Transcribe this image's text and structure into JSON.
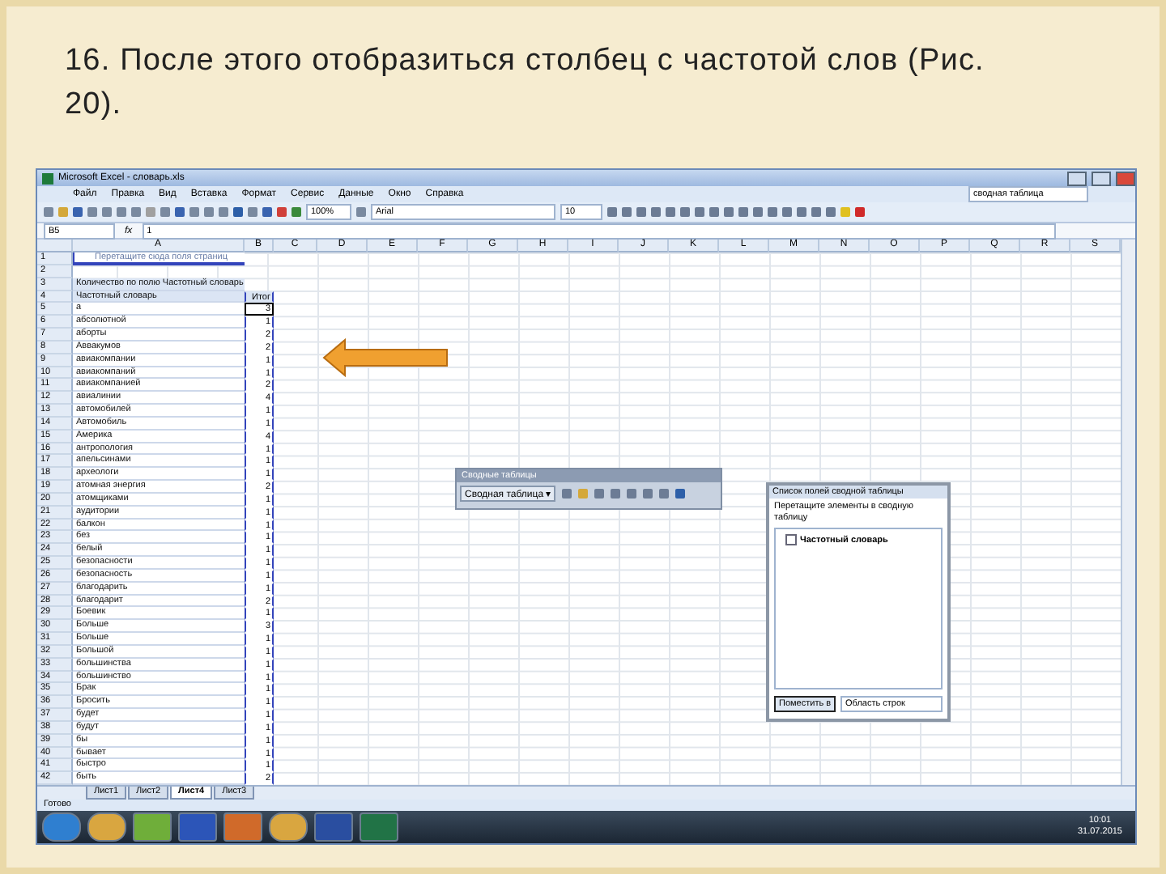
{
  "heading": "16. После этого отобразиться столбец с частотой слов (Рис. 20).",
  "window": {
    "title": "Microsoft Excel - словарь.xls"
  },
  "menu": [
    "Файл",
    "Правка",
    "Вид",
    "Вставка",
    "Формат",
    "Сервис",
    "Данные",
    "Окно",
    "Справка"
  ],
  "help_box": {
    "value": "сводная таблица"
  },
  "zoom_box": {
    "value": "100%"
  },
  "font_box": {
    "value": "Arial"
  },
  "size_box": {
    "value": "10"
  },
  "name_box": {
    "value": "B5"
  },
  "formula": {
    "label": "fx",
    "value": "1"
  },
  "columns": [
    "A",
    "B",
    "C",
    "D",
    "E",
    "F",
    "G",
    "H",
    "I",
    "J",
    "K",
    "L",
    "M",
    "N",
    "O",
    "P",
    "Q",
    "R",
    "S"
  ],
  "rows": [
    {
      "number": "1",
      "kind": "drop",
      "a": "Перетащите сюда поля страниц"
    },
    {
      "number": "2"
    },
    {
      "number": "3",
      "kind": "header",
      "a": "Количество по полю Частотный словарь"
    },
    {
      "number": "4",
      "kind": "field",
      "a": "Частотный словарь",
      "b": "Итог"
    },
    {
      "number": "5",
      "kind": "data",
      "a": "а",
      "b": "3",
      "selected": true
    },
    {
      "number": "6",
      "kind": "data",
      "a": "абсолютной",
      "b": "1",
      "selected": false
    },
    {
      "number": "7",
      "kind": "data",
      "a": "аборты",
      "b": "2",
      "selected": false
    },
    {
      "number": "8",
      "kind": "data",
      "a": "Аввакумов",
      "b": "2",
      "selected": false
    },
    {
      "number": "9",
      "kind": "data",
      "a": "авиакомпании",
      "b": "1",
      "selected": false
    },
    {
      "number": "10",
      "kind": "data",
      "a": "авиакомпаний",
      "b": "1",
      "selected": false
    },
    {
      "number": "11",
      "kind": "data",
      "a": "авиакомпанией",
      "b": "2",
      "selected": false
    },
    {
      "number": "12",
      "kind": "data",
      "a": "авиалинии",
      "b": "4",
      "selected": false
    },
    {
      "number": "13",
      "kind": "data",
      "a": "автомобилей",
      "b": "1",
      "selected": false
    },
    {
      "number": "14",
      "kind": "data",
      "a": "Автомобиль",
      "b": "1",
      "selected": false
    },
    {
      "number": "15",
      "kind": "data",
      "a": "Америка",
      "b": "4",
      "selected": false
    },
    {
      "number": "16",
      "kind": "data",
      "a": "антропология",
      "b": "1",
      "selected": false
    },
    {
      "number": "17",
      "kind": "data",
      "a": "апельсинами",
      "b": "1",
      "selected": false
    },
    {
      "number": "18",
      "kind": "data",
      "a": "археологи",
      "b": "1",
      "selected": false
    },
    {
      "number": "19",
      "kind": "data",
      "a": "атомная энергия",
      "b": "2",
      "selected": false
    },
    {
      "number": "20",
      "kind": "data",
      "a": "атомщиками",
      "b": "1",
      "selected": false
    },
    {
      "number": "21",
      "kind": "data",
      "a": "аудитории",
      "b": "1",
      "selected": false
    },
    {
      "number": "22",
      "kind": "data",
      "a": "балкон",
      "b": "1",
      "selected": false
    },
    {
      "number": "23",
      "kind": "data",
      "a": "без",
      "b": "1",
      "selected": false
    },
    {
      "number": "24",
      "kind": "data",
      "a": "белый",
      "b": "1",
      "selected": false
    },
    {
      "number": "25",
      "kind": "data",
      "a": "безопасности",
      "b": "1",
      "selected": false
    },
    {
      "number": "26",
      "kind": "data",
      "a": "безопасность",
      "b": "1",
      "selected": false
    },
    {
      "number": "27",
      "kind": "data",
      "a": "благодарить",
      "b": "1",
      "selected": false
    },
    {
      "number": "28",
      "kind": "data",
      "a": "благодарит",
      "b": "2",
      "selected": false
    },
    {
      "number": "29",
      "kind": "data",
      "a": "Боевик",
      "b": "1",
      "selected": false
    },
    {
      "number": "30",
      "kind": "data",
      "a": "Больше",
      "b": "3",
      "selected": false
    },
    {
      "number": "31",
      "kind": "data",
      "a": "Больше",
      "b": "1",
      "selected": false
    },
    {
      "number": "32",
      "kind": "data",
      "a": "Большой",
      "b": "1",
      "selected": false
    },
    {
      "number": "33",
      "kind": "data",
      "a": "большинства",
      "b": "1",
      "selected": false
    },
    {
      "number": "34",
      "kind": "data",
      "a": "большинство",
      "b": "1",
      "selected": false
    },
    {
      "number": "35",
      "kind": "data",
      "a": "Брак",
      "b": "1",
      "selected": false
    },
    {
      "number": "36",
      "kind": "data",
      "a": "Бросить",
      "b": "1",
      "selected": false
    },
    {
      "number": "37",
      "kind": "data",
      "a": "будет",
      "b": "1",
      "selected": false
    },
    {
      "number": "38",
      "kind": "data",
      "a": "будут",
      "b": "1",
      "selected": false
    },
    {
      "number": "39",
      "kind": "data",
      "a": "бы",
      "b": "1",
      "selected": false
    },
    {
      "number": "40",
      "kind": "data",
      "a": "бывает",
      "b": "1",
      "selected": false
    },
    {
      "number": "41",
      "kind": "data",
      "a": "быстро",
      "b": "1",
      "selected": false
    },
    {
      "number": "42",
      "kind": "data",
      "a": "быть",
      "b": "2",
      "selected": false
    }
  ],
  "pivot_toolbar": {
    "title": "Сводные таблицы",
    "menu": "Сводная таблица ▾"
  },
  "field_list": {
    "title": "Список полей сводной таблицы",
    "hint": "Перетащите элементы в сводную таблицу",
    "fields": [
      {
        "label": "Частотный словарь",
        "checked": false
      }
    ],
    "button": "Поместить в",
    "area": "Область строк"
  },
  "sheet_tabs": [
    {
      "label": "Лист1",
      "selected": false
    },
    {
      "label": "Лист2",
      "selected": false
    },
    {
      "label": "Лист4",
      "selected": true
    },
    {
      "label": "Лист3",
      "selected": false
    }
  ],
  "status": "Готово",
  "taskbar": {
    "apps": [
      {
        "kind": "start"
      },
      {
        "kind": "browser"
      },
      {
        "kind": "torrent"
      },
      {
        "kind": "save"
      },
      {
        "kind": "slides"
      },
      {
        "kind": "browser"
      },
      {
        "kind": "word"
      },
      {
        "kind": "excel"
      }
    ],
    "time": "10:01",
    "date": "31.07.2015"
  }
}
